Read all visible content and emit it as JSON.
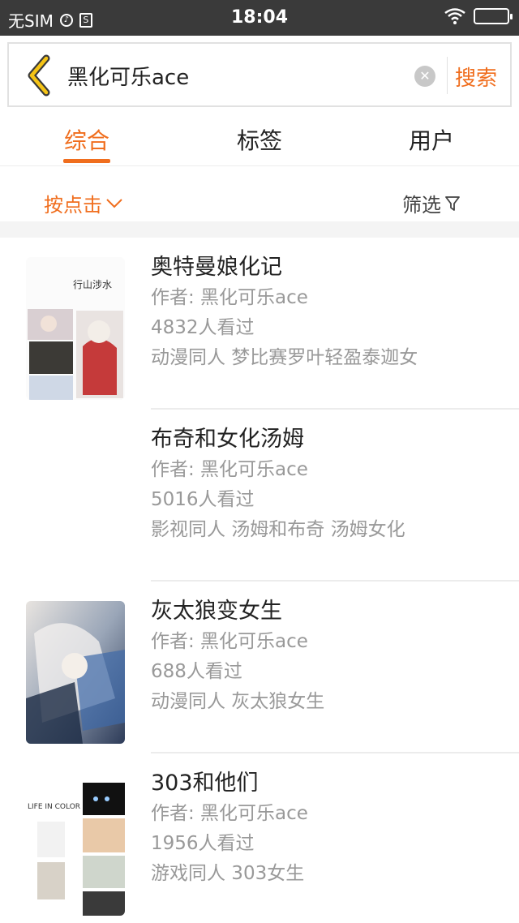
{
  "status_bar": {
    "carrier": "无SIM",
    "time": "18:04",
    "icons": [
      "music-icon",
      "s-app-icon",
      "wifi-icon",
      "battery-icon"
    ]
  },
  "search": {
    "query": "黑化可乐ace",
    "button_label": "搜索"
  },
  "tabs": [
    {
      "label": "综合",
      "active": true
    },
    {
      "label": "标签",
      "active": false
    },
    {
      "label": "用户",
      "active": false
    }
  ],
  "sort": {
    "label": "按点击"
  },
  "filter": {
    "label": "筛选"
  },
  "results": [
    {
      "title": "奥特曼娘化记",
      "author": "作者: 黑化可乐ace",
      "views": "4832人看过",
      "tags": "动漫同人 梦比赛罗叶轻盈泰迦女",
      "thumb_text": "行山涉水"
    },
    {
      "title": "布奇和女化汤姆",
      "author": "作者: 黑化可乐ace",
      "views": "5016人看过",
      "tags": "影视同人 汤姆和布奇 汤姆女化"
    },
    {
      "title": "灰太狼变女生",
      "author": "作者: 黑化可乐ace",
      "views": "688人看过",
      "tags": "动漫同人 灰太狼女生"
    },
    {
      "title": "303和他们",
      "author": "作者: 黑化可乐ace",
      "views": "1956人看过",
      "tags": "游戏同人 303女生",
      "thumb_text": "LIFE IN COLOR"
    }
  ],
  "colors": {
    "accent": "#f06e1e",
    "status_bar": "#3a3a3a",
    "meta_text": "#999999"
  }
}
